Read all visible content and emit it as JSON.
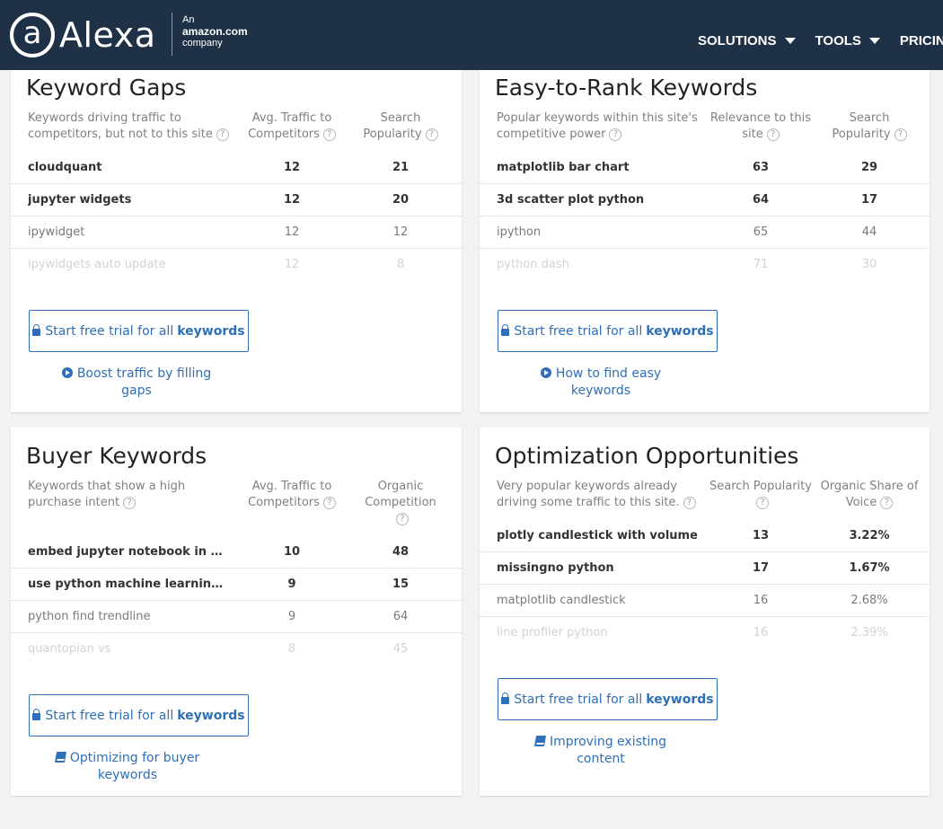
{
  "header": {
    "logo_symbol": "a",
    "logo_text": "Alexa",
    "amazon_line1": "An",
    "amazon_line2": "amazon.com",
    "amazon_line3": "company",
    "nav": [
      "SOLUTIONS",
      "TOOLS",
      "PRICIN"
    ],
    "bg_color": "#1f3147"
  },
  "accent_color": "#2e6fb7",
  "cards": [
    {
      "title": "Keyword Gaps",
      "col1": "Keywords driving traffic to competitors, but not to this site",
      "col2": "Avg. Traffic to Competitors",
      "col3": "Search Popularity",
      "rows": [
        {
          "kw": "cloudquant",
          "v1": "12",
          "v2": "21"
        },
        {
          "kw": "jupyter widgets",
          "v1": "12",
          "v2": "20"
        },
        {
          "kw": "ipywidget",
          "v1": "12",
          "v2": "12"
        },
        {
          "kw": "ipywidgets auto update",
          "v1": "12",
          "v2": "8"
        }
      ],
      "button_prefix": "Start free trial for all",
      "button_bold": "keywords",
      "link_text": "Boost traffic by filling gaps",
      "link_icon": "play-circle-icon"
    },
    {
      "title": "Easy-to-Rank Keywords",
      "col1": "Popular keywords within this site's competitive power",
      "col2": "Relevance to this site",
      "col3": "Search Popularity",
      "rows": [
        {
          "kw": "matplotlib bar chart",
          "v1": "63",
          "v2": "29"
        },
        {
          "kw": "3d scatter plot python",
          "v1": "64",
          "v2": "17"
        },
        {
          "kw": "ipython",
          "v1": "65",
          "v2": "44"
        },
        {
          "kw": "python dash",
          "v1": "71",
          "v2": "30"
        }
      ],
      "button_prefix": "Start free trial for all",
      "button_bold": "keywords",
      "link_text": "How to find easy keywords",
      "link_icon": "play-circle-icon"
    },
    {
      "title": "Buyer Keywords",
      "col1": "Keywords that show a high purchase intent",
      "col2": "Avg. Traffic to Competitors",
      "col3": "Organic Competition",
      "rows": [
        {
          "kw": "embed jupyter notebook in websi...",
          "v1": "10",
          "v2": "48"
        },
        {
          "kw": "use python machine learning to fi...",
          "v1": "9",
          "v2": "15"
        },
        {
          "kw": "python find trendline",
          "v1": "9",
          "v2": "64"
        },
        {
          "kw": "quantopian vs",
          "v1": "8",
          "v2": "45"
        }
      ],
      "button_prefix": "Start free trial for all",
      "button_bold": "keywords",
      "link_text": "Optimizing for buyer keywords",
      "link_icon": "book-icon"
    },
    {
      "title": "Optimization Opportunities",
      "col1": "Very popular keywords already driving some traffic to this site.",
      "col2": "Search Popularity",
      "col3": "Organic Share of Voice",
      "rows": [
        {
          "kw": "plotly candlestick with volume",
          "v1": "13",
          "v2": "3.22%"
        },
        {
          "kw": "missingno python",
          "v1": "17",
          "v2": "1.67%"
        },
        {
          "kw": "matplotlib candlestick",
          "v1": "16",
          "v2": "2.68%"
        },
        {
          "kw": "line profiler python",
          "v1": "16",
          "v2": "2.39%"
        }
      ],
      "button_prefix": "Start free trial for all",
      "button_bold": "keywords",
      "link_text": "Improving existing content",
      "link_icon": "book-icon"
    }
  ]
}
